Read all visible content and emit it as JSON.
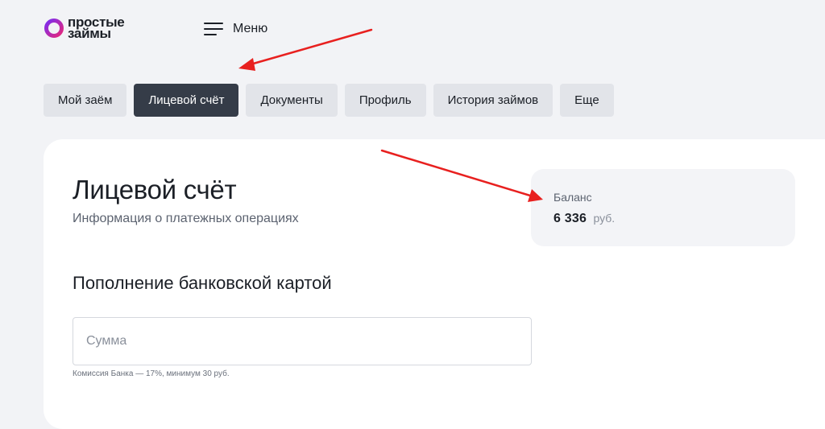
{
  "header": {
    "logo_line1": "простые",
    "logo_line2": "займы",
    "menu_label": "Меню"
  },
  "tabs": [
    {
      "label": "Мой заём",
      "active": false
    },
    {
      "label": "Лицевой счёт",
      "active": true
    },
    {
      "label": "Документы",
      "active": false
    },
    {
      "label": "Профиль",
      "active": false
    },
    {
      "label": "История займов",
      "active": false
    },
    {
      "label": "Еще",
      "active": false
    }
  ],
  "main": {
    "title": "Лицевой счёт",
    "subtitle": "Информация о платежных операциях",
    "balance": {
      "label": "Баланс",
      "amount": "6 336",
      "currency": "руб."
    },
    "topup": {
      "title": "Пополнение банковской картой",
      "amount_placeholder": "Сумма",
      "amount_value": "",
      "commission_note": "Комиссия Банка — 17%, минимум 30 руб."
    }
  },
  "colors": {
    "background": "#f2f3f6",
    "card": "#ffffff",
    "tab": "#e2e4e9",
    "tab_active": "#353c48",
    "logo_gradient_start": "#7a2cf0",
    "logo_gradient_end": "#e6287a",
    "annotation_arrow": "#e8201f"
  },
  "icons": {
    "logo": "brand-ring-icon",
    "menu": "hamburger-icon",
    "annotations": "arrow-icon"
  }
}
